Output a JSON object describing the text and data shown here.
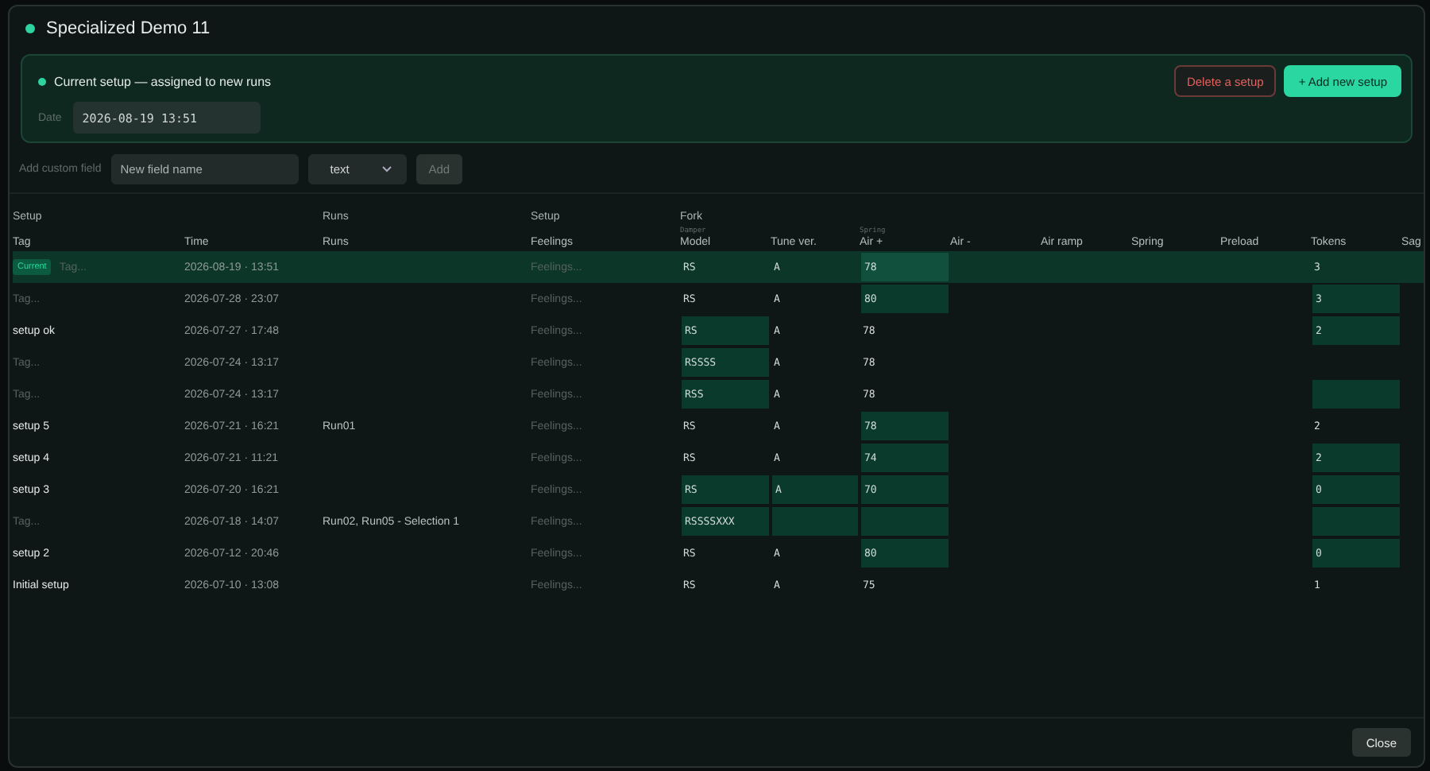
{
  "dialog": {
    "title": "Specialized Demo 11"
  },
  "current_setup": {
    "label": "Current setup — assigned to new runs",
    "date_label": "Date",
    "date_value": "2026-08-19 13:51",
    "delete_button": "Delete a setup",
    "add_button": "+ Add new setup"
  },
  "custom_field": {
    "label": "Add custom field",
    "placeholder": "New field name",
    "type_value": "text",
    "add_button": "Add",
    "add_disabled": true
  },
  "table": {
    "columns": [
      {
        "label": "Tag",
        "group": "Setup"
      },
      {
        "label": "Time"
      },
      {
        "label": "Runs",
        "group": "Runs"
      },
      {
        "label": "Feelings",
        "group": "Setup"
      },
      {
        "label": "Model",
        "group": "Fork",
        "subgroup": "Damper"
      },
      {
        "label": "Tune ver."
      },
      {
        "label": "Air +",
        "subgroup": "Spring"
      },
      {
        "label": "Air -"
      },
      {
        "label": "Air ramp"
      },
      {
        "label": "Spring"
      },
      {
        "label": "Preload"
      },
      {
        "label": "Tokens"
      },
      {
        "label": "Sag"
      }
    ],
    "rows": [
      {
        "selected": true,
        "badge": "Current",
        "tag_placeholder": "Tag...",
        "time": "2026-08-19 · 13:51",
        "feelings_placeholder": "Feelings...",
        "model": {
          "value": "RS",
          "changed": false
        },
        "tune": {
          "value": "A",
          "changed": false
        },
        "air_plus": {
          "value": "78",
          "changed": true
        },
        "tokens": {
          "value": "3",
          "changed": false
        }
      },
      {
        "selected": false,
        "tag_placeholder": "Tag...",
        "time": "2026-07-28 · 23:07",
        "feelings_placeholder": "Feelings...",
        "model": {
          "value": "RS",
          "changed": false
        },
        "tune": {
          "value": "A",
          "changed": false
        },
        "air_plus": {
          "value": "80",
          "changed": true
        },
        "tokens": {
          "value": "3",
          "changed": true
        }
      },
      {
        "selected": false,
        "tag": "setup ok",
        "time": "2026-07-27 · 17:48",
        "feelings_placeholder": "Feelings...",
        "model": {
          "value": "RS",
          "changed": true
        },
        "tune": {
          "value": "A",
          "changed": false
        },
        "air_plus": {
          "value": "78",
          "changed": false
        },
        "tokens": {
          "value": "2",
          "changed": true
        }
      },
      {
        "selected": false,
        "tag_placeholder": "Tag...",
        "time": "2026-07-24 · 13:17",
        "feelings_placeholder": "Feelings...",
        "model": {
          "value": "RSSSS",
          "changed": true
        },
        "tune": {
          "value": "A",
          "changed": false
        },
        "air_plus": {
          "value": "78",
          "changed": false
        }
      },
      {
        "selected": false,
        "tag_placeholder": "Tag...",
        "time": "2026-07-24 · 13:17",
        "feelings_placeholder": "Feelings...",
        "model": {
          "value": "RSS",
          "changed": true
        },
        "tune": {
          "value": "A",
          "changed": false
        },
        "air_plus": {
          "value": "78",
          "changed": false
        },
        "tokens": {
          "changed": true
        }
      },
      {
        "selected": false,
        "tag": "setup 5",
        "time": "2026-07-21 · 16:21",
        "runs": "Run01",
        "feelings_placeholder": "Feelings...",
        "model": {
          "value": "RS",
          "changed": false
        },
        "tune": {
          "value": "A",
          "changed": false
        },
        "air_plus": {
          "value": "78",
          "changed": true
        },
        "tokens": {
          "value": "2",
          "changed": false
        }
      },
      {
        "selected": false,
        "tag": "setup 4",
        "time": "2026-07-21 · 11:21",
        "feelings_placeholder": "Feelings...",
        "model": {
          "value": "RS",
          "changed": false
        },
        "tune": {
          "value": "A",
          "changed": false
        },
        "air_plus": {
          "value": "74",
          "changed": true
        },
        "tokens": {
          "value": "2",
          "changed": true
        }
      },
      {
        "selected": false,
        "tag": "setup 3",
        "time": "2026-07-20 · 16:21",
        "feelings_placeholder": "Feelings...",
        "model": {
          "value": "RS",
          "changed": true
        },
        "tune": {
          "value": "A",
          "changed": true
        },
        "air_plus": {
          "value": "70",
          "changed": true
        },
        "tokens": {
          "value": "0",
          "changed": true
        }
      },
      {
        "selected": false,
        "tag_placeholder": "Tag...",
        "time": "2026-07-18 · 14:07",
        "runs": "Run02, Run05 - Selection 1",
        "feelings_placeholder": "Feelings...",
        "model": {
          "value": "RSSSSXXX",
          "changed": true
        },
        "tune": {
          "changed": true
        },
        "air_plus": {
          "changed": true
        },
        "tokens": {
          "changed": true
        }
      },
      {
        "selected": false,
        "tag": "setup 2",
        "time": "2026-07-12 · 20:46",
        "feelings_placeholder": "Feelings...",
        "model": {
          "value": "RS",
          "changed": false
        },
        "tune": {
          "value": "A",
          "changed": false
        },
        "air_plus": {
          "value": "80",
          "changed": true
        },
        "tokens": {
          "value": "0",
          "changed": true
        }
      },
      {
        "selected": false,
        "tag": "Initial setup",
        "time": "2026-07-10 · 13:08",
        "feelings_placeholder": "Feelings...",
        "model": {
          "value": "RS",
          "changed": false
        },
        "tune": {
          "value": "A",
          "changed": false
        },
        "air_plus": {
          "value": "75",
          "changed": false
        },
        "tokens": {
          "value": "1",
          "changed": false
        }
      }
    ]
  },
  "footer": {
    "close_button": "Close"
  }
}
